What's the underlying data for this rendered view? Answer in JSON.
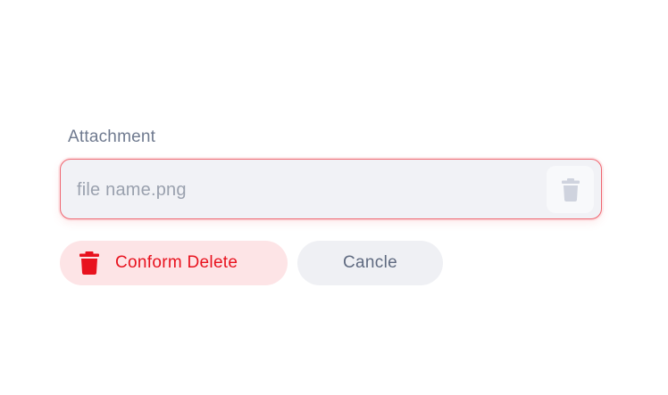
{
  "attachment": {
    "label": "Attachment",
    "file_name": "file name.png",
    "trash_icon": "trash-icon"
  },
  "actions": {
    "confirm_delete_label": "Conform Delete",
    "confirm_delete_icon": "trash-icon",
    "cancel_label": "Cancle"
  },
  "colors": {
    "danger": "#e8121e",
    "danger_bg": "#fde4e6",
    "field_bg": "#f1f2f6",
    "field_border": "#f0636e",
    "neutral_bg": "#eff0f4",
    "neutral_text": "#5f6a80"
  }
}
